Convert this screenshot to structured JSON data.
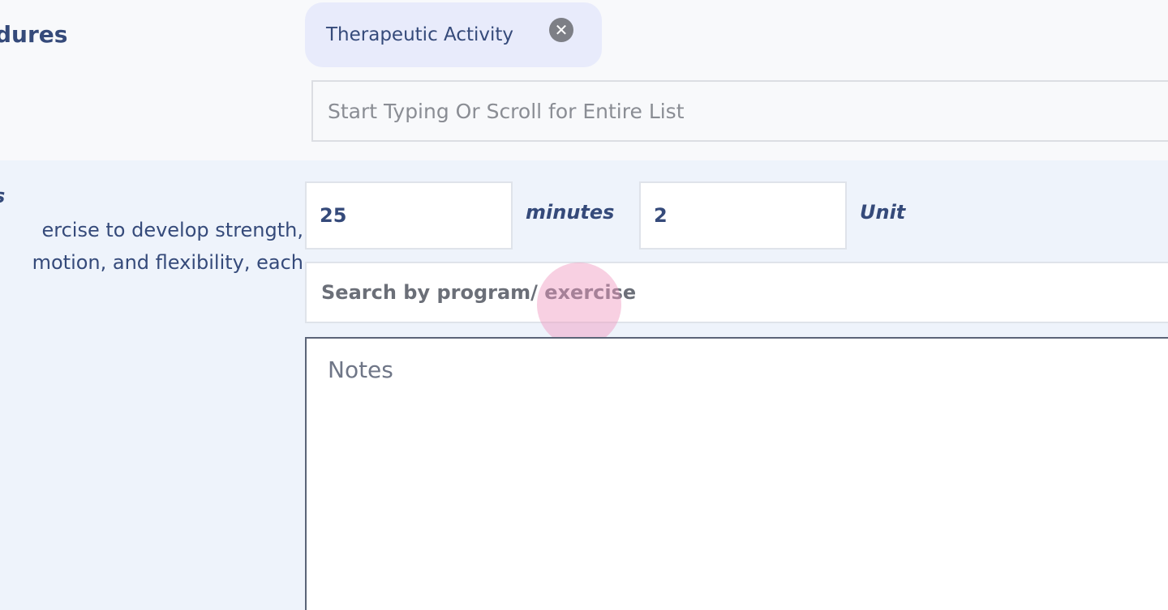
{
  "procedures": {
    "title": "dures",
    "selected_chip": {
      "label": "Therapeutic Activity",
      "remove_icon": "close-circle-icon"
    },
    "search": {
      "placeholder": "Start Typing Or Scroll for Entire List",
      "value": ""
    }
  },
  "activity": {
    "name": "s",
    "description_lines": [
      "ercise to develop strength,",
      "motion, and flexibility, each"
    ],
    "minutes": {
      "value": "25",
      "label": "minutes"
    },
    "units": {
      "value": "2",
      "label": "Unit"
    },
    "program_search": {
      "placeholder": "Search by program/ exercise",
      "value": ""
    },
    "notes": {
      "placeholder": "Notes",
      "value": ""
    }
  },
  "colors": {
    "text_primary": "#354a7a",
    "chip_background": "#e8ebfb",
    "section_background": "#eef3fb",
    "cursor_highlight": "#f096be"
  }
}
